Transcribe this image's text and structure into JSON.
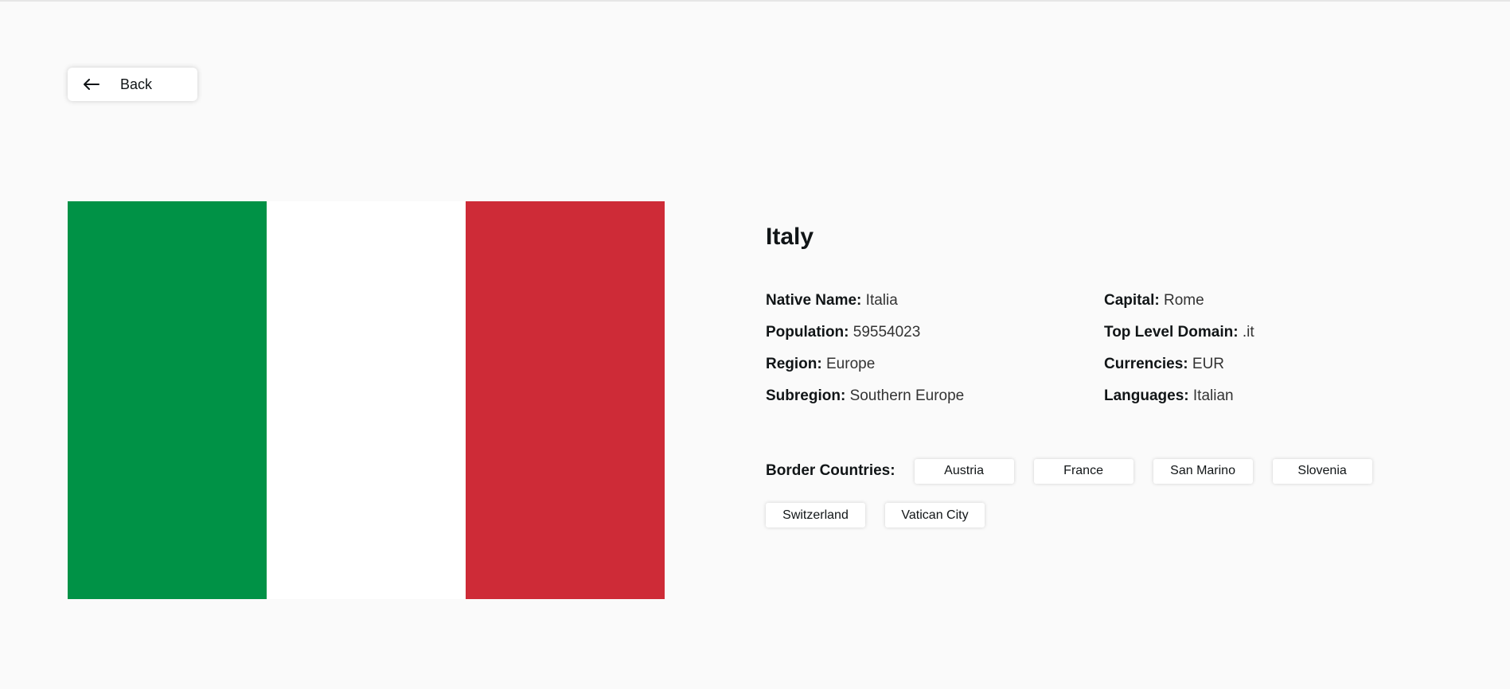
{
  "back_button": {
    "label": "Back",
    "icon": "arrow-left-icon"
  },
  "country": {
    "name": "Italy",
    "flag": {
      "colors": [
        "#009246",
        "#ffffff",
        "#ce2b37"
      ]
    },
    "left_column": [
      {
        "key": "Native Name:",
        "value": "Italia"
      },
      {
        "key": "Population:",
        "value": "59554023"
      },
      {
        "key": "Region:",
        "value": "Europe"
      },
      {
        "key": "Subregion:",
        "value": "Southern Europe"
      }
    ],
    "right_column": [
      {
        "key": "Capital:",
        "value": "Rome"
      },
      {
        "key": "Top Level Domain:",
        "value": ".it"
      },
      {
        "key": "Currencies:",
        "value": "EUR"
      },
      {
        "key": "Languages:",
        "value": "Italian"
      }
    ],
    "borders_label": "Border Countries:",
    "borders": [
      "Austria",
      "France",
      "San Marino",
      "Slovenia",
      "Switzerland",
      "Vatican City"
    ]
  }
}
